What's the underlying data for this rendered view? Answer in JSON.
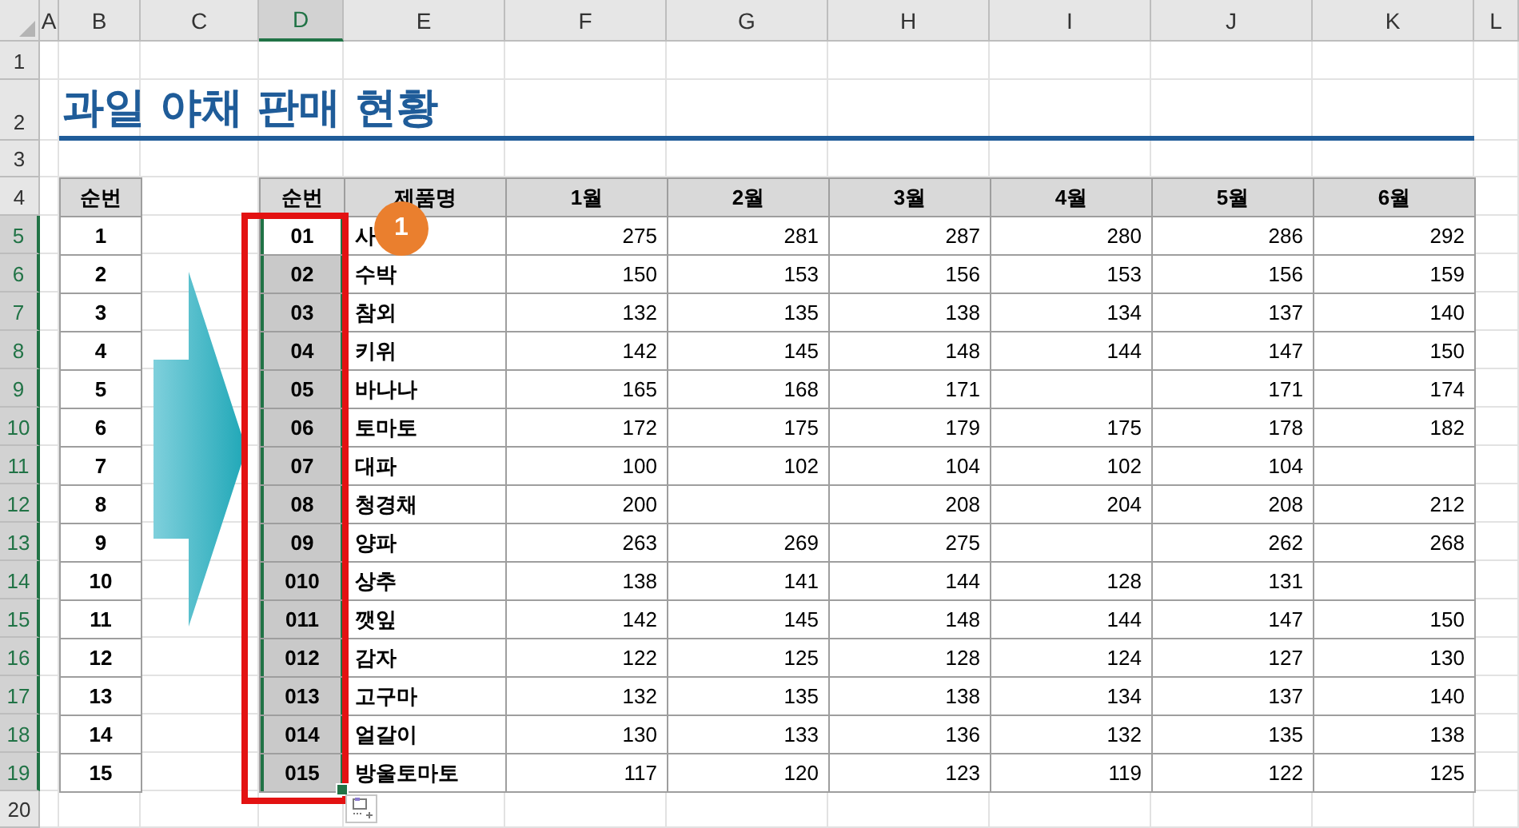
{
  "sheet": {
    "columns": [
      {
        "label": "A",
        "selected": false
      },
      {
        "label": "B",
        "selected": false
      },
      {
        "label": "C",
        "selected": false
      },
      {
        "label": "D",
        "selected": true
      },
      {
        "label": "E",
        "selected": false
      },
      {
        "label": "F",
        "selected": false
      },
      {
        "label": "G",
        "selected": false
      },
      {
        "label": "H",
        "selected": false
      },
      {
        "label": "I",
        "selected": false
      },
      {
        "label": "J",
        "selected": false
      },
      {
        "label": "K",
        "selected": false
      },
      {
        "label": "L",
        "selected": false
      }
    ],
    "rows": [
      {
        "label": "1",
        "selected": false
      },
      {
        "label": "2",
        "selected": false
      },
      {
        "label": "3",
        "selected": false
      },
      {
        "label": "4",
        "selected": false
      },
      {
        "label": "5",
        "selected": true
      },
      {
        "label": "6",
        "selected": true
      },
      {
        "label": "7",
        "selected": true
      },
      {
        "label": "8",
        "selected": true
      },
      {
        "label": "9",
        "selected": true
      },
      {
        "label": "10",
        "selected": true
      },
      {
        "label": "11",
        "selected": true
      },
      {
        "label": "12",
        "selected": true
      },
      {
        "label": "13",
        "selected": true
      },
      {
        "label": "14",
        "selected": true
      },
      {
        "label": "15",
        "selected": true
      },
      {
        "label": "16",
        "selected": true
      },
      {
        "label": "17",
        "selected": true
      },
      {
        "label": "18",
        "selected": true
      },
      {
        "label": "19",
        "selected": true
      },
      {
        "label": "20",
        "selected": false
      }
    ]
  },
  "title": "과일 야채 판매 현황",
  "index_table": {
    "header": "순번",
    "rows": [
      "1",
      "2",
      "3",
      "4",
      "5",
      "6",
      "7",
      "8",
      "9",
      "10",
      "11",
      "12",
      "13",
      "14",
      "15"
    ]
  },
  "sales_table": {
    "columns": [
      "순번",
      "제품명",
      "1월",
      "2월",
      "3월",
      "4월",
      "5월",
      "6월"
    ],
    "rows": [
      {
        "code": "01",
        "name": "사",
        "m1": "275",
        "m2": "281",
        "m3": "287",
        "m4": "280",
        "m5": "286",
        "m6": "292",
        "selected": true,
        "active": true
      },
      {
        "code": "02",
        "name": "수박",
        "m1": "150",
        "m2": "153",
        "m3": "156",
        "m4": "153",
        "m5": "156",
        "m6": "159",
        "selected": true,
        "active": false
      },
      {
        "code": "03",
        "name": "참외",
        "m1": "132",
        "m2": "135",
        "m3": "138",
        "m4": "134",
        "m5": "137",
        "m6": "140",
        "selected": true,
        "active": false
      },
      {
        "code": "04",
        "name": "키위",
        "m1": "142",
        "m2": "145",
        "m3": "148",
        "m4": "144",
        "m5": "147",
        "m6": "150",
        "selected": true,
        "active": false
      },
      {
        "code": "05",
        "name": "바나나",
        "m1": "165",
        "m2": "168",
        "m3": "171",
        "m5": "171",
        "m6": "174",
        "selected": true,
        "active": false
      },
      {
        "code": "06",
        "name": "토마토",
        "m1": "172",
        "m2": "175",
        "m3": "179",
        "m4": "175",
        "m5": "178",
        "m6": "182",
        "selected": true,
        "active": false
      },
      {
        "code": "07",
        "name": "대파",
        "m1": "100",
        "m2": "102",
        "m3": "104",
        "m4": "102",
        "m5": "104",
        "selected": true,
        "active": false
      },
      {
        "code": "08",
        "name": "청경채",
        "m1": "200",
        "m3": "208",
        "m4": "204",
        "m5": "208",
        "m6": "212",
        "selected": true,
        "active": false
      },
      {
        "code": "09",
        "name": "양파",
        "m1": "263",
        "m2": "269",
        "m3": "275",
        "m5": "262",
        "m6": "268",
        "selected": true,
        "active": false
      },
      {
        "code": "010",
        "name": "상추",
        "m1": "138",
        "m2": "141",
        "m3": "144",
        "m4": "128",
        "m5": "131",
        "selected": true,
        "active": false
      },
      {
        "code": "011",
        "name": "깻잎",
        "m1": "142",
        "m2": "145",
        "m3": "148",
        "m4": "144",
        "m5": "147",
        "m6": "150",
        "selected": true,
        "active": false
      },
      {
        "code": "012",
        "name": "감자",
        "m1": "122",
        "m2": "125",
        "m3": "128",
        "m4": "124",
        "m5": "127",
        "m6": "130",
        "selected": true,
        "active": false
      },
      {
        "code": "013",
        "name": "고구마",
        "m1": "132",
        "m2": "135",
        "m3": "138",
        "m4": "134",
        "m5": "137",
        "m6": "140",
        "selected": true,
        "active": false
      },
      {
        "code": "014",
        "name": "얼갈이",
        "m1": "130",
        "m2": "133",
        "m3": "136",
        "m4": "132",
        "m5": "135",
        "m6": "138",
        "selected": true,
        "active": false
      },
      {
        "code": "015",
        "name": "방울토마토",
        "m1": "117",
        "m2": "120",
        "m3": "123",
        "m4": "119",
        "m5": "122",
        "m6": "125",
        "selected": true,
        "active": false
      }
    ]
  },
  "callout": {
    "label": "1"
  }
}
